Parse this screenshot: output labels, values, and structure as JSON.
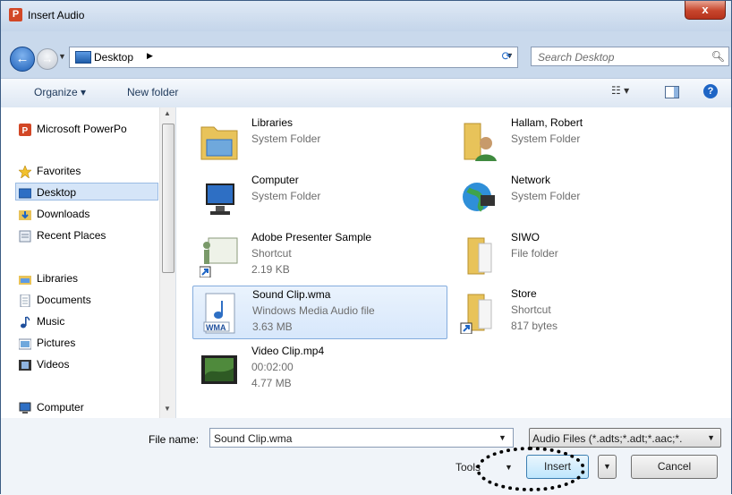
{
  "window": {
    "title": "Insert Audio",
    "close_glyph": "x",
    "app_icon_letter": "P"
  },
  "address": {
    "location": "Desktop",
    "search_placeholder": "Search Desktop"
  },
  "toolbar": {
    "organize_label": "Organize ▾",
    "new_folder_label": "New folder"
  },
  "nav": {
    "items": [
      {
        "label": "Microsoft PowerPo",
        "icon": "powerpoint-icon"
      },
      {
        "label": "Favorites",
        "icon": "star-icon"
      },
      {
        "label": "Desktop",
        "icon": "desktop-icon",
        "selected": true
      },
      {
        "label": "Downloads",
        "icon": "downloads-icon"
      },
      {
        "label": "Recent Places",
        "icon": "recent-places-icon"
      },
      {
        "label": "Libraries",
        "icon": "libraries-icon"
      },
      {
        "label": "Documents",
        "icon": "document-icon"
      },
      {
        "label": "Music",
        "icon": "music-icon"
      },
      {
        "label": "Pictures",
        "icon": "pictures-icon"
      },
      {
        "label": "Videos",
        "icon": "videos-icon"
      },
      {
        "label": "Computer",
        "icon": "computer-icon"
      }
    ]
  },
  "files": [
    {
      "name": "Libraries",
      "lines": [
        "System Folder"
      ],
      "icon": "libraries-folder-icon"
    },
    {
      "name": "Hallam, Robert",
      "lines": [
        "System Folder"
      ],
      "icon": "user-folder-icon"
    },
    {
      "name": "Computer",
      "lines": [
        "System Folder"
      ],
      "icon": "computer-icon"
    },
    {
      "name": "Network",
      "lines": [
        "System Folder"
      ],
      "icon": "network-icon"
    },
    {
      "name": "Adobe Presenter Sample",
      "lines": [
        "Shortcut",
        "2.19 KB"
      ],
      "icon": "presenter-shortcut-icon"
    },
    {
      "name": "SIWO",
      "lines": [
        "File folder"
      ],
      "icon": "folder-icon"
    },
    {
      "name": "Sound Clip.wma",
      "lines": [
        "Windows Media Audio file",
        "3.63 MB"
      ],
      "icon": "wma-file-icon",
      "selected": true,
      "badge": "WMA"
    },
    {
      "name": "Store",
      "lines": [
        "Shortcut",
        "817 bytes"
      ],
      "icon": "folder-shortcut-icon"
    },
    {
      "name": "Video Clip.mp4",
      "lines": [
        "00:02:00",
        "4.77 MB"
      ],
      "icon": "video-thumbnail-icon"
    }
  ],
  "bottom": {
    "filename_label": "File name:",
    "filename_value": "Sound Clip.wma",
    "filetype_value": "Audio Files (*.adts;*.adt;*.aac;*.",
    "tools_label": "Tools",
    "insert_label": "Insert",
    "cancel_label": "Cancel"
  },
  "colors": {
    "accent": "#1e65c5",
    "selection": "#d5e5f8",
    "highlight_ring": "#000000"
  }
}
